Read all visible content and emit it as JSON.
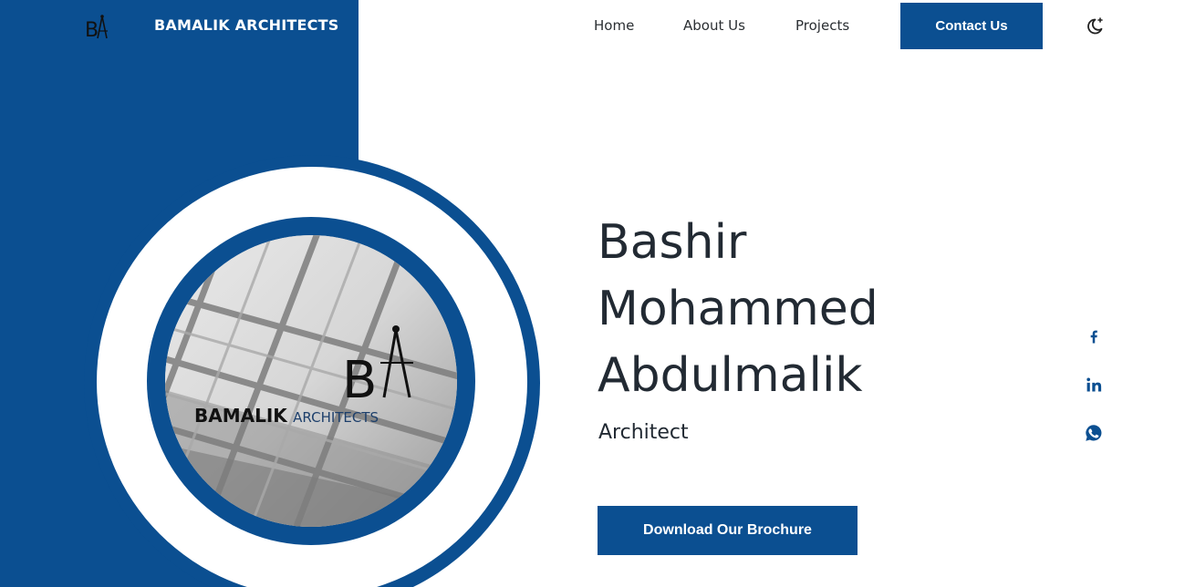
{
  "brand": {
    "name": "BAMALIK ARCHITECTS",
    "logo_icon": "compass-logo-icon"
  },
  "nav": {
    "items": [
      {
        "label": "Home"
      },
      {
        "label": "About Us"
      },
      {
        "label": "Projects"
      }
    ],
    "contact_label": "Contact Us",
    "theme_icon": "moon-star-icon"
  },
  "hero": {
    "name_line1": "Bashir",
    "name_line2": "Mohammed",
    "name_line3": "Abdulmalik",
    "role": "Architect",
    "cta_label": "Download Our Brochure",
    "photo": {
      "logo_word": "BAMALIK",
      "logo_sub": "ARCHITECTS"
    }
  },
  "social": [
    {
      "icon": "facebook-icon"
    },
    {
      "icon": "linkedin-icon"
    },
    {
      "icon": "whatsapp-icon"
    }
  ],
  "colors": {
    "brand_blue": "#0b4f91",
    "text_dark": "#222a33",
    "background": "#ffffff"
  }
}
